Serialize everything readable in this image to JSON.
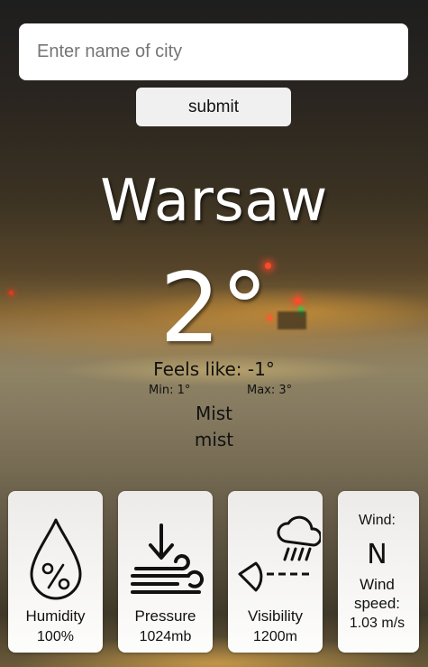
{
  "search": {
    "placeholder": "Enter name of city",
    "value": "",
    "submit_label": "submit"
  },
  "weather": {
    "city": "Warsaw",
    "temperature": "2°",
    "feels_like": "Feels like: -1°",
    "min": "Min: 1°",
    "max": "Max: 3°",
    "condition_main": "Mist",
    "condition_desc": "mist"
  },
  "cards": {
    "humidity": {
      "icon": "humidity-drop-icon",
      "label": "Humidity",
      "value": "100%"
    },
    "pressure": {
      "icon": "pressure-icon",
      "label": "Pressure",
      "value": "1024mb"
    },
    "visibility": {
      "icon": "visibility-icon",
      "label": "Visibility",
      "value": "1200m"
    },
    "wind": {
      "label": "Wind:",
      "direction": "N",
      "speed_label_1": "Wind",
      "speed_label_2": "speed:",
      "speed_value": "1.03 m/s"
    }
  },
  "colors": {
    "text_light": "#ffffff",
    "text_dark": "#111111",
    "card_bg": "#f4f3f1"
  }
}
